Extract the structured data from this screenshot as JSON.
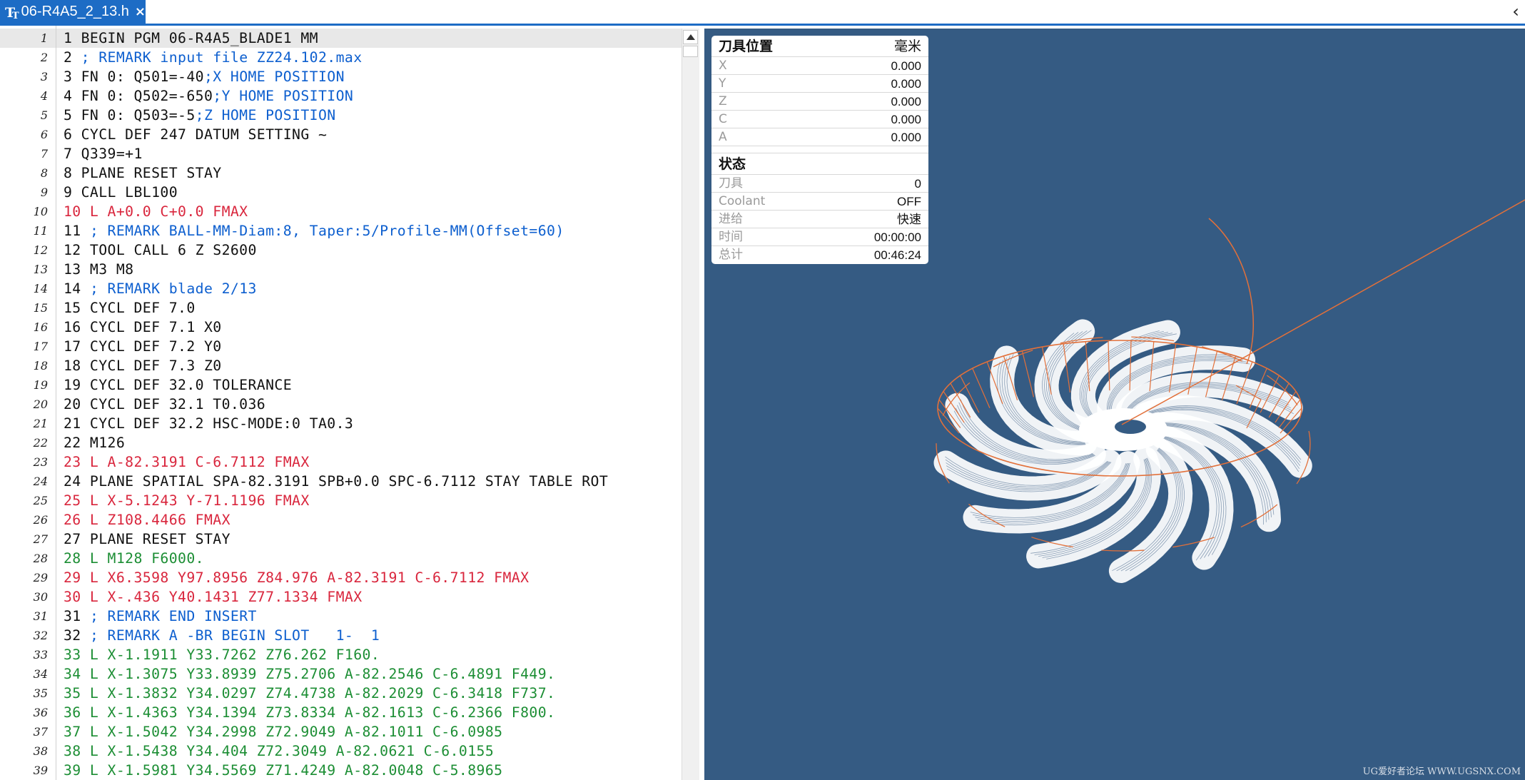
{
  "tab": {
    "title": "06-R4A5_2_13.h",
    "close": "×"
  },
  "collapse_glyph": "‹",
  "editor": {
    "lines": [
      {
        "no": "1",
        "color": "black",
        "text": "1 BEGIN PGM 06-R4A5_BLADE1 MM"
      },
      {
        "no": "2",
        "color": "mixed",
        "parts": [
          {
            "c": "black",
            "t": "2 "
          },
          {
            "c": "blue",
            "t": "; REMARK input file ZZ24.102.max"
          }
        ]
      },
      {
        "no": "3",
        "color": "mixed",
        "parts": [
          {
            "c": "black",
            "t": "3 FN 0: Q501=-40"
          },
          {
            "c": "blue",
            "t": ";X HOME POSITION"
          }
        ]
      },
      {
        "no": "4",
        "color": "mixed",
        "parts": [
          {
            "c": "black",
            "t": "4 FN 0: Q502=-650"
          },
          {
            "c": "blue",
            "t": ";Y HOME POSITION"
          }
        ]
      },
      {
        "no": "5",
        "color": "mixed",
        "parts": [
          {
            "c": "black",
            "t": "5 FN 0: Q503=-5"
          },
          {
            "c": "blue",
            "t": ";Z HOME POSITION"
          }
        ]
      },
      {
        "no": "6",
        "color": "black",
        "text": "6 CYCL DEF 247 DATUM SETTING ~"
      },
      {
        "no": "7",
        "color": "black",
        "text": "7 Q339=+1"
      },
      {
        "no": "8",
        "color": "black",
        "text": "8 PLANE RESET STAY"
      },
      {
        "no": "9",
        "color": "black",
        "text": "9 CALL LBL100"
      },
      {
        "no": "10",
        "color": "red",
        "text": "10 L A+0.0 C+0.0 FMAX"
      },
      {
        "no": "11",
        "color": "mixed",
        "parts": [
          {
            "c": "black",
            "t": "11 "
          },
          {
            "c": "blue",
            "t": "; REMARK BALL-MM-Diam:8, Taper:5/Profile-MM(Offset=60)"
          }
        ]
      },
      {
        "no": "12",
        "color": "black",
        "text": "12 TOOL CALL 6 Z S2600"
      },
      {
        "no": "13",
        "color": "black",
        "text": "13 M3 M8"
      },
      {
        "no": "14",
        "color": "mixed",
        "parts": [
          {
            "c": "black",
            "t": "14 "
          },
          {
            "c": "blue",
            "t": "; REMARK blade 2/13"
          }
        ]
      },
      {
        "no": "15",
        "color": "black",
        "text": "15 CYCL DEF 7.0"
      },
      {
        "no": "16",
        "color": "black",
        "text": "16 CYCL DEF 7.1 X0"
      },
      {
        "no": "17",
        "color": "black",
        "text": "17 CYCL DEF 7.2 Y0"
      },
      {
        "no": "18",
        "color": "black",
        "text": "18 CYCL DEF 7.3 Z0"
      },
      {
        "no": "19",
        "color": "black",
        "text": "19 CYCL DEF 32.0 TOLERANCE"
      },
      {
        "no": "20",
        "color": "black",
        "text": "20 CYCL DEF 32.1 T0.036"
      },
      {
        "no": "21",
        "color": "black",
        "text": "21 CYCL DEF 32.2 HSC-MODE:0 TA0.3"
      },
      {
        "no": "22",
        "color": "black",
        "text": "22 M126"
      },
      {
        "no": "23",
        "color": "red",
        "text": "23 L A-82.3191 C-6.7112 FMAX"
      },
      {
        "no": "24",
        "color": "black",
        "text": "24 PLANE SPATIAL SPA-82.3191 SPB+0.0 SPC-6.7112 STAY TABLE ROT"
      },
      {
        "no": "25",
        "color": "red",
        "text": "25 L X-5.1243 Y-71.1196 FMAX"
      },
      {
        "no": "26",
        "color": "red",
        "text": "26 L Z108.4466 FMAX"
      },
      {
        "no": "27",
        "color": "black",
        "text": "27 PLANE RESET STAY"
      },
      {
        "no": "28",
        "color": "green",
        "text": "28 L M128 F6000."
      },
      {
        "no": "29",
        "color": "red",
        "text": "29 L X6.3598 Y97.8956 Z84.976 A-82.3191 C-6.7112 FMAX"
      },
      {
        "no": "30",
        "color": "red",
        "text": "30 L X-.436 Y40.1431 Z77.1334 FMAX"
      },
      {
        "no": "31",
        "color": "mixed",
        "parts": [
          {
            "c": "black",
            "t": "31 "
          },
          {
            "c": "blue",
            "t": "; REMARK END INSERT"
          }
        ]
      },
      {
        "no": "32",
        "color": "mixed",
        "parts": [
          {
            "c": "black",
            "t": "32 "
          },
          {
            "c": "blue",
            "t": "; REMARK A -BR BEGIN SLOT   1-  1"
          }
        ]
      },
      {
        "no": "33",
        "color": "green",
        "text": "33 L X-1.1911 Y33.7262 Z76.262 F160."
      },
      {
        "no": "34",
        "color": "green",
        "text": "34 L X-1.3075 Y33.8939 Z75.2706 A-82.2546 C-6.4891 F449."
      },
      {
        "no": "35",
        "color": "green",
        "text": "35 L X-1.3832 Y34.0297 Z74.4738 A-82.2029 C-6.3418 F737."
      },
      {
        "no": "36",
        "color": "green",
        "text": "36 L X-1.4363 Y34.1394 Z73.8334 A-82.1613 C-6.2366 F800."
      },
      {
        "no": "37",
        "color": "green",
        "text": "37 L X-1.5042 Y34.2998 Z72.9049 A-82.1011 C-6.0985"
      },
      {
        "no": "38",
        "color": "green",
        "text": "38 L X-1.5438 Y34.404 Z72.3049 A-82.0621 C-6.0155"
      },
      {
        "no": "39",
        "color": "green",
        "text": "39 L X-1.5981 Y34.5569 Z71.4249 A-82.0048 C-5.8965"
      }
    ]
  },
  "panel": {
    "position_title": "刀具位置",
    "unit": "毫米",
    "axes": [
      {
        "label": "X",
        "value": "0.000"
      },
      {
        "label": "Y",
        "value": "0.000"
      },
      {
        "label": "Z",
        "value": "0.000"
      },
      {
        "label": "C",
        "value": "0.000"
      },
      {
        "label": "A",
        "value": "0.000"
      }
    ],
    "status_title": "状态",
    "status": [
      {
        "label": "刀具",
        "value": "0"
      },
      {
        "label": "Coolant",
        "value": "OFF"
      },
      {
        "label": "进给",
        "value": "快速"
      },
      {
        "label": "时间",
        "value": "00:00:00"
      },
      {
        "label": "总计",
        "value": "00:46:24"
      }
    ]
  },
  "watermark": "UG爱好者论坛 WWW.UGSNX.COM",
  "colors": {
    "tab": "#1d6cc5",
    "viewport_bg": "#355b83",
    "toolpath": "#e2703a",
    "blade": "#ffffff"
  }
}
